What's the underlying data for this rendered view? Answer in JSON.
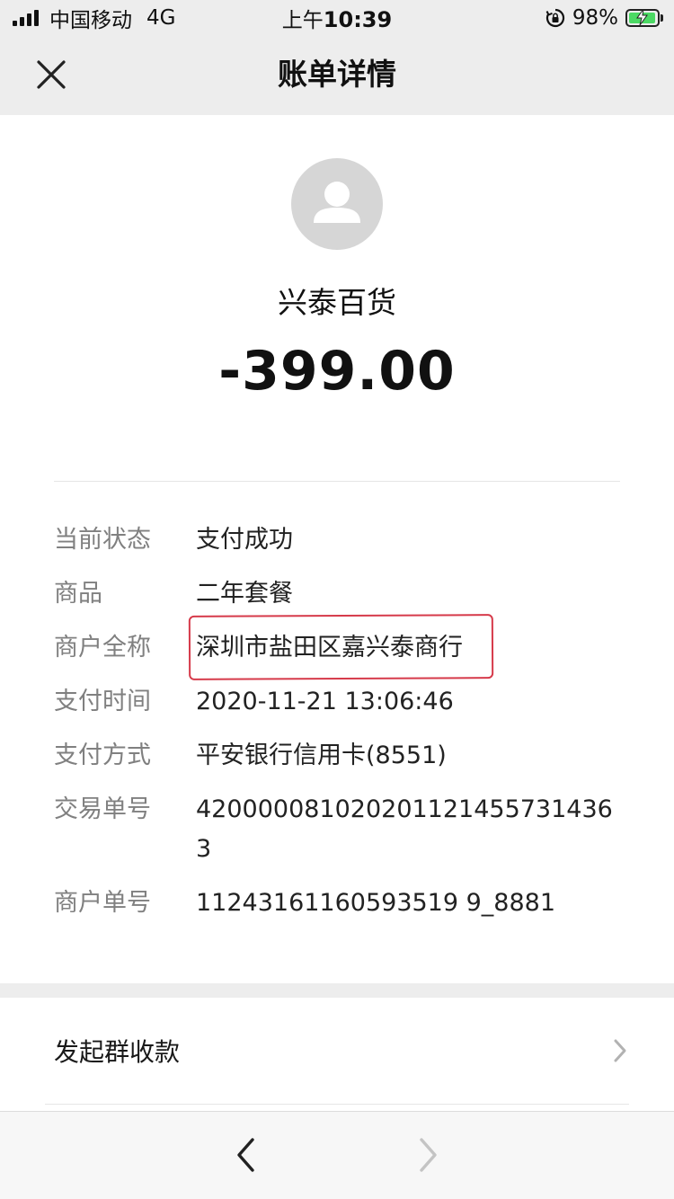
{
  "status_bar": {
    "carrier": "中国移动",
    "network": "4G",
    "time_prefix": "上午",
    "time": "10:39",
    "battery": "98%",
    "battery_level": 0.98
  },
  "nav": {
    "title": "账单详情",
    "close_icon": "close-icon"
  },
  "bill": {
    "merchant_name": "兴泰百货",
    "amount": "-399.00",
    "avatar_icon": "person-icon"
  },
  "details": [
    {
      "label": "当前状态",
      "value": "支付成功"
    },
    {
      "label": "商品",
      "value": "二年套餐"
    },
    {
      "label": "商户全称",
      "value": "深圳市盐田区嘉兴泰商行"
    },
    {
      "label": "支付时间",
      "value": "2020-11-21 13:06:46"
    },
    {
      "label": "支付方式",
      "value": "平安银行信用卡(8551)"
    },
    {
      "label": "交易单号",
      "value": "4200000810202011214557314363"
    },
    {
      "label": "商户单号",
      "value": "11243161160593519 9_8881"
    }
  ],
  "actions": {
    "group_collect": "发起群收款"
  },
  "colors": {
    "background": "#ededed",
    "card": "#ffffff",
    "label_gray": "#808080",
    "highlight_red": "#d63a4a"
  }
}
